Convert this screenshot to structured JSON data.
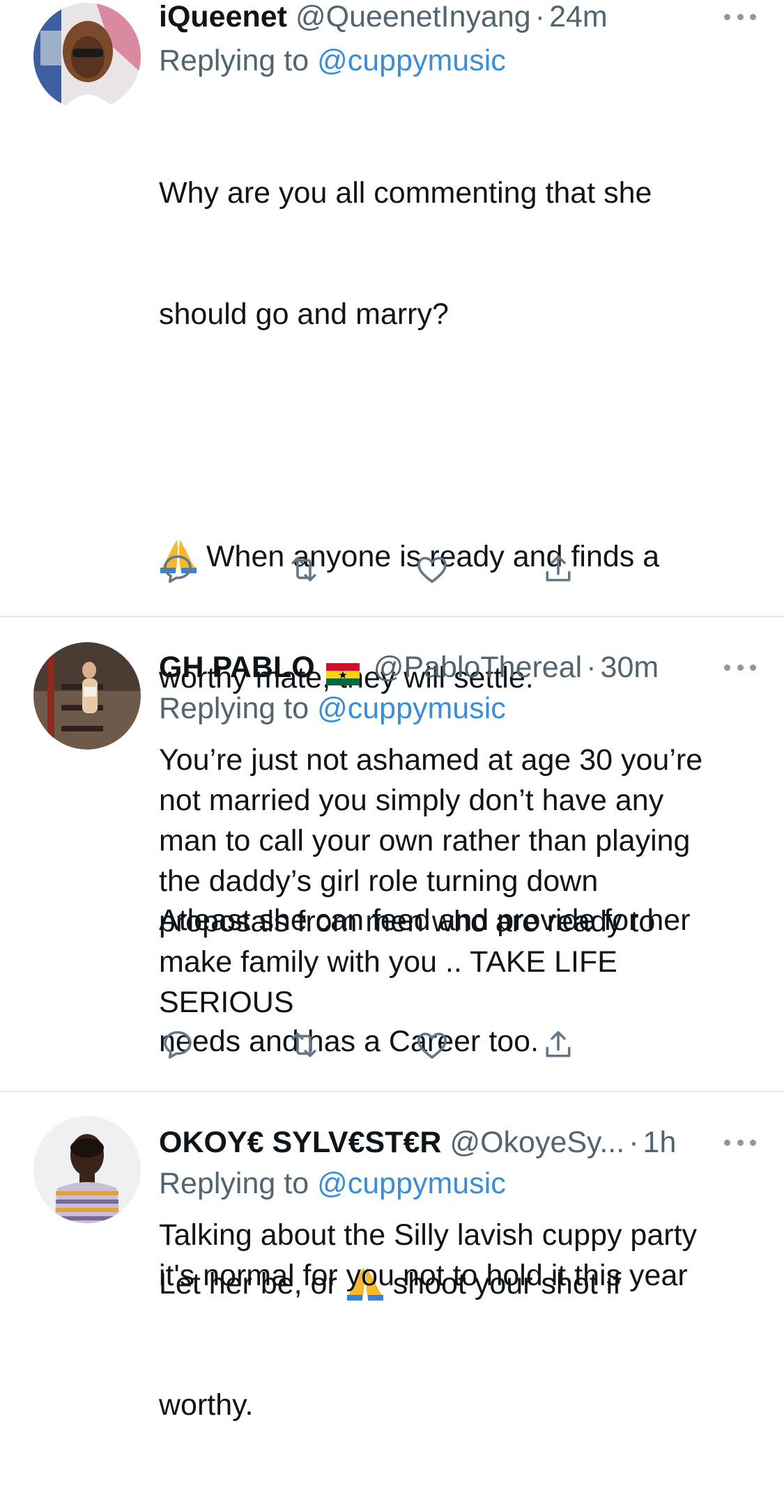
{
  "tweets": [
    {
      "display_name": "iQueenet",
      "handle": "@QueenetInyang",
      "separator": "·",
      "time": "24m",
      "replying_prefix": "Replying to",
      "replying_to": "@cuppymusic",
      "text_lines": [
        "Why are you all commenting that she",
        "should go and marry?",
        "",
        "When anyone is ready and finds a",
        "worthy mate, they will settle.",
        "",
        "Atleast she can feed and provide for her",
        "needs and has a Career too.",
        "",
        "Let her be, or",
        "shoot your shot if",
        "worthy."
      ],
      "emoji": "folded-hands-emoji",
      "has_flag": false
    },
    {
      "display_name": "GH PABLO",
      "handle": "@PabloThereal",
      "separator": "·",
      "time": "30m",
      "replying_prefix": "Replying to",
      "replying_to": "@cuppymusic",
      "text": "You’re just not ashamed at age 30 you’re\nnot married you simply don’t have any\nman to call your own rather than playing\nthe daddy’s girl role turning down\nproposals from men who are ready to\nmake family with you .. TAKE LIFE\nSERIOUS",
      "has_flag": true,
      "flag": "ghana-flag-icon"
    },
    {
      "display_name": "OKOY€ SYLV€ST€R",
      "handle": "@OkoyeSy...",
      "separator": "·",
      "time": "1h",
      "replying_prefix": "Replying to",
      "replying_to": "@cuppymusic",
      "text": "Talking about the Silly lavish cuppy party\nit's normal for you not to hold it this year",
      "has_flag": false
    }
  ],
  "actions": [
    "reply-icon",
    "retweet-icon",
    "like-icon",
    "share-icon"
  ],
  "colors": {
    "text": "#0f1419",
    "secondary": "#536471",
    "link": "#3b8ed6",
    "icon": "#657786",
    "divider": "#e6e9ec"
  }
}
